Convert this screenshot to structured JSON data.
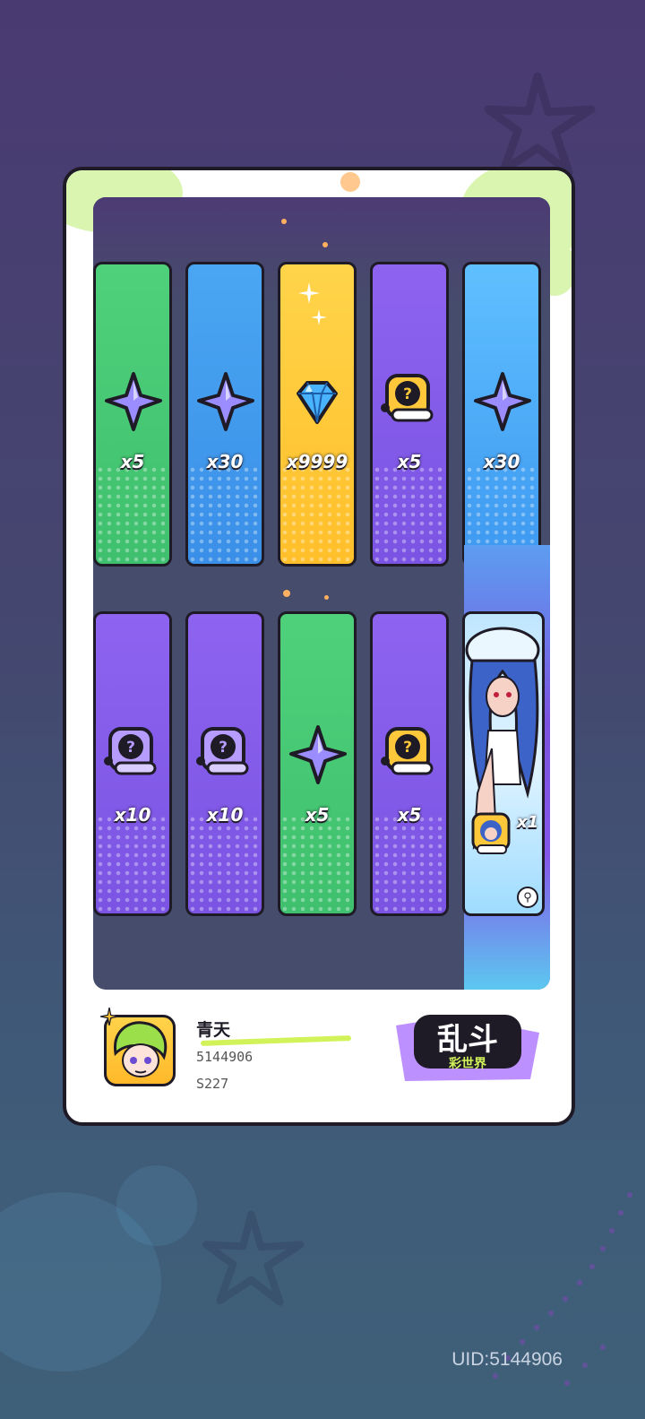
{
  "rewards_row1": [
    {
      "color": "green",
      "icon": "star-shard-icon",
      "qty": "x5"
    },
    {
      "color": "blue",
      "icon": "star-shard-icon",
      "qty": "x30"
    },
    {
      "color": "yellow",
      "icon": "diamond-icon",
      "qty": "x9999"
    },
    {
      "color": "purple",
      "icon": "mystery-badge-icon",
      "qty": "x5"
    },
    {
      "color": "sky",
      "icon": "star-shard-icon",
      "qty": "x30"
    }
  ],
  "rewards_row2": [
    {
      "color": "purple",
      "icon": "mystery-badge-dark-icon",
      "qty": "x10"
    },
    {
      "color": "purple",
      "icon": "mystery-badge-dark-icon",
      "qty": "x10"
    },
    {
      "color": "green",
      "icon": "star-shard-icon",
      "qty": "x5"
    },
    {
      "color": "purple",
      "icon": "mystery-badge-icon",
      "qty": "x5"
    }
  ],
  "special_reward": {
    "icon": "character-card-icon",
    "qty": "x1"
  },
  "player": {
    "name": "青天",
    "id": "5144906",
    "server": "S227"
  },
  "logo": {
    "title": "乱斗",
    "subtitle": "彩世界"
  },
  "footer_uid": "UID:5144906",
  "colors": {
    "green": "#4fd07a",
    "blue": "#4aa6f2",
    "yellow": "#ffd44a",
    "purple": "#8d63f0",
    "sky": "#5fc0ff",
    "outline": "#1e1b26"
  }
}
